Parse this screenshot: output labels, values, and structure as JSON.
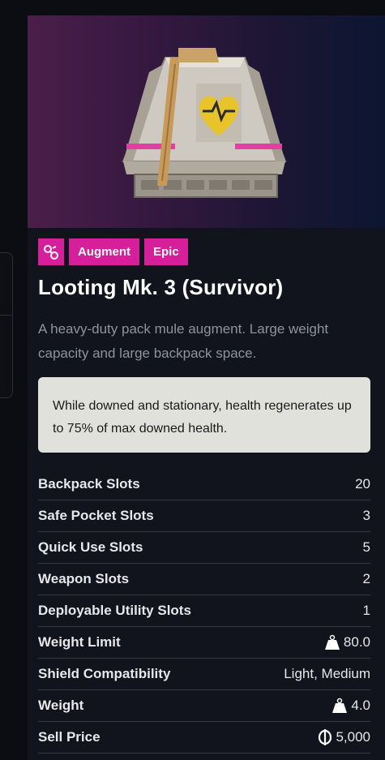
{
  "item": {
    "tags": {
      "type_icon": "augment-chain-icon",
      "category": "Augment",
      "rarity": "Epic"
    },
    "name": "Looting Mk. 3 (Survivor)",
    "description": "A heavy-duty pack mule augment. Large weight capacity and large backpack space.",
    "effect": "While downed and stationary, health regenerates up to 75% of max downed health."
  },
  "stats": [
    {
      "label": "Backpack Slots",
      "value": "20",
      "icon": null
    },
    {
      "label": "Safe Pocket Slots",
      "value": "3",
      "icon": null
    },
    {
      "label": "Quick Use Slots",
      "value": "5",
      "icon": null
    },
    {
      "label": "Weapon Slots",
      "value": "2",
      "icon": null
    },
    {
      "label": "Deployable Utility Slots",
      "value": "1",
      "icon": null
    },
    {
      "label": "Weight Limit",
      "value": "80.0",
      "icon": "weight-icon"
    },
    {
      "label": "Shield Compatibility",
      "value": "Light, Medium",
      "icon": null
    },
    {
      "label": "Weight",
      "value": "4.0",
      "icon": "weight-icon"
    },
    {
      "label": "Sell Price",
      "value": "5,000",
      "icon": "coin-icon"
    }
  ],
  "colors": {
    "rarity_badge": "#d61f9b",
    "effect_background": "#e1e1dc",
    "card_background": "#11141c"
  }
}
